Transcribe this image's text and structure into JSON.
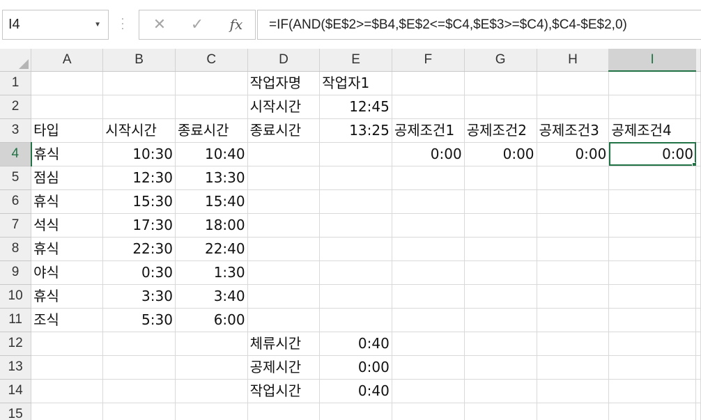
{
  "name_box": {
    "value": "I4"
  },
  "formula_bar": {
    "cancel_icon": "x-icon",
    "enter_icon": "check-icon",
    "fx_label": "fx",
    "formula": "=IF(AND($E$2>=$B4,$E$2<=$C4,$E$3>=$C4),$C4-$E$2,0)"
  },
  "columns": [
    "A",
    "B",
    "C",
    "D",
    "E",
    "F",
    "G",
    "H",
    "I"
  ],
  "selected_cell": {
    "col": "I",
    "row": 4
  },
  "rows": [
    {
      "num": "1",
      "cells": [
        "",
        "",
        "",
        "작업자명",
        "작업자1",
        "",
        "",
        "",
        ""
      ]
    },
    {
      "num": "2",
      "cells": [
        "",
        "",
        "",
        "시작시간",
        "12:45",
        "",
        "",
        "",
        ""
      ]
    },
    {
      "num": "3",
      "cells": [
        "타입",
        "시작시간",
        "종료시간",
        "종료시간",
        "13:25",
        "공제조건1",
        "공제조건2",
        "공제조건3",
        "공제조건4"
      ]
    },
    {
      "num": "4",
      "cells": [
        "휴식",
        "10:30",
        "10:40",
        "",
        "",
        "0:00",
        "0:00",
        "0:00",
        "0:00"
      ]
    },
    {
      "num": "5",
      "cells": [
        "점심",
        "12:30",
        "13:30",
        "",
        "",
        "",
        "",
        "",
        ""
      ]
    },
    {
      "num": "6",
      "cells": [
        "휴식",
        "15:30",
        "15:40",
        "",
        "",
        "",
        "",
        "",
        ""
      ]
    },
    {
      "num": "7",
      "cells": [
        "석식",
        "17:30",
        "18:00",
        "",
        "",
        "",
        "",
        "",
        ""
      ]
    },
    {
      "num": "8",
      "cells": [
        "휴식",
        "22:30",
        "22:40",
        "",
        "",
        "",
        "",
        "",
        ""
      ]
    },
    {
      "num": "9",
      "cells": [
        "야식",
        "0:30",
        "1:30",
        "",
        "",
        "",
        "",
        "",
        ""
      ]
    },
    {
      "num": "10",
      "cells": [
        "휴식",
        "3:30",
        "3:40",
        "",
        "",
        "",
        "",
        "",
        ""
      ]
    },
    {
      "num": "11",
      "cells": [
        "조식",
        "5:30",
        "6:00",
        "",
        "",
        "",
        "",
        "",
        ""
      ]
    },
    {
      "num": "12",
      "cells": [
        "",
        "",
        "",
        "체류시간",
        "0:40",
        "",
        "",
        "",
        ""
      ]
    },
    {
      "num": "13",
      "cells": [
        "",
        "",
        "",
        "공제시간",
        "0:00",
        "",
        "",
        "",
        ""
      ]
    },
    {
      "num": "14",
      "cells": [
        "",
        "",
        "",
        "작업시간",
        "0:40",
        "",
        "",
        "",
        ""
      ]
    },
    {
      "num": "15",
      "cells": [
        "",
        "",
        "",
        "",
        "",
        "",
        "",
        "",
        ""
      ]
    }
  ],
  "colors": {
    "accent": "#217346",
    "header_bg": "#efefef",
    "gridline": "#d9d9d9"
  }
}
